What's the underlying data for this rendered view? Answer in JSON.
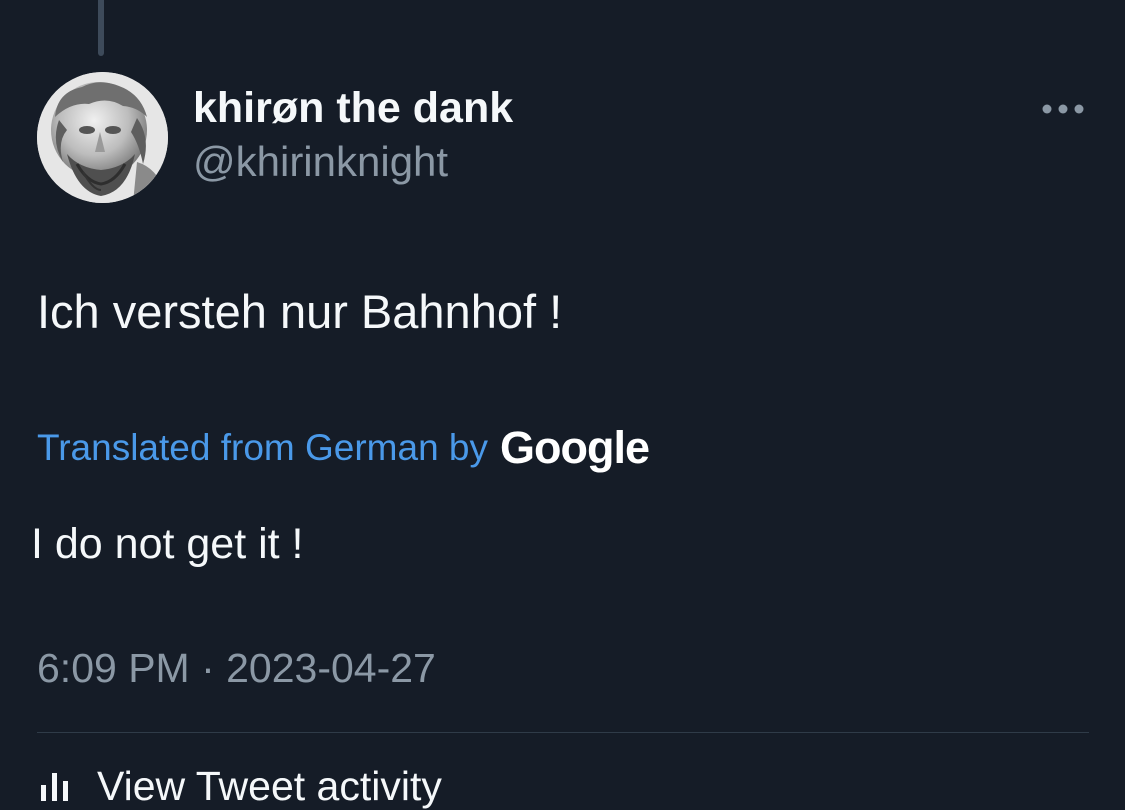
{
  "author": {
    "display_name": "khirøn the dank",
    "handle": "@khirinknight"
  },
  "tweet": {
    "text": "Ich versteh nur Bahnhof !",
    "translation_notice": "Translated from German by",
    "translation_provider": "Google",
    "translated_text": "I do not get it !",
    "timestamp": "6:09 PM · 2023-04-27"
  },
  "footer": {
    "activity_label": "View Tweet activity"
  },
  "icons": {
    "more": "more-horizontal-icon",
    "activity": "bar-chart-icon"
  },
  "colors": {
    "background": "#151c27",
    "link": "#4a99e9",
    "secondary_text": "#8b98a5",
    "primary_text": "#f5f8fa"
  }
}
